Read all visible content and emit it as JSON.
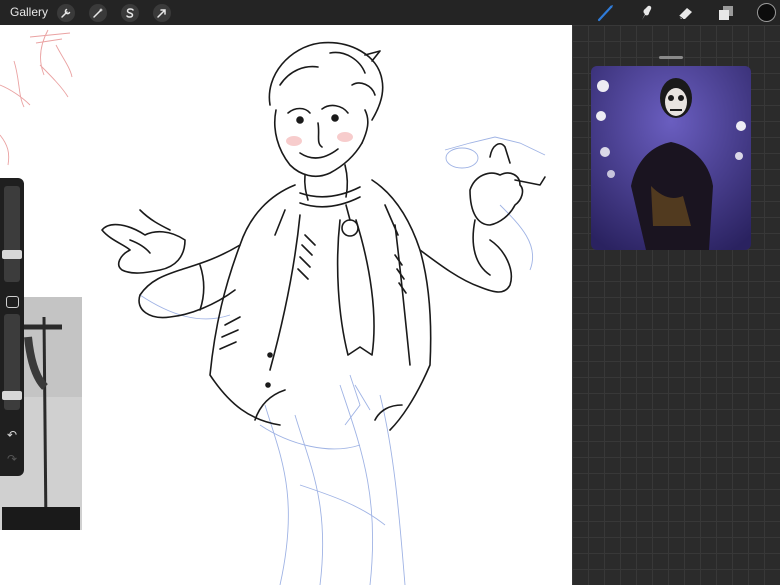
{
  "topbar": {
    "gallery_label": "Gallery",
    "left_tools": [
      {
        "name": "actions",
        "icon": "wrench-icon"
      },
      {
        "name": "adjustments",
        "icon": "magic-wand-icon"
      },
      {
        "name": "selection",
        "icon": "selection-s-icon"
      },
      {
        "name": "transform",
        "icon": "arrow-cursor-icon"
      }
    ],
    "right_tools": [
      {
        "name": "brush",
        "icon": "brush-icon",
        "active": true
      },
      {
        "name": "smudge",
        "icon": "smudge-finger-icon"
      },
      {
        "name": "eraser",
        "icon": "eraser-icon"
      },
      {
        "name": "layers",
        "icon": "layers-icon"
      }
    ],
    "current_color": "#0c0c0c",
    "active_tool_color": "#2f7bd8"
  },
  "sidebar": {
    "brush_size_level": 0.27,
    "opacity_level": 0.12,
    "undo_icon": "undo-arrow-icon",
    "redo_icon": "redo-arrow-icon"
  },
  "colors": {
    "canvas": "#ffffff",
    "workspace": "#2b2b2b",
    "ink": "#1a1a1a",
    "sketch_blue": "#8fa6e0",
    "sketch_red": "#e58b8b"
  }
}
